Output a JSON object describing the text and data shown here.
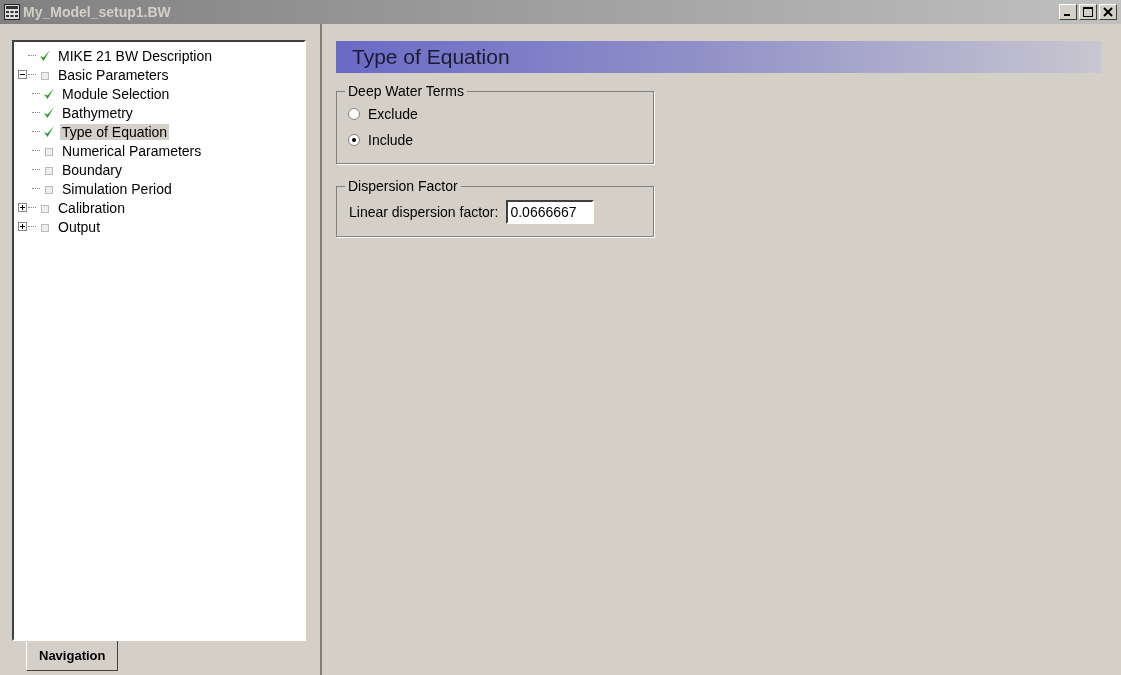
{
  "window": {
    "title": "My_Model_setup1.BW"
  },
  "tree": [
    {
      "label": "MIKE 21 BW Description",
      "checked": true,
      "selected": false
    },
    {
      "label": "Basic Parameters",
      "checked": false,
      "selected": false,
      "expanded": true,
      "children": [
        {
          "label": "Module Selection",
          "checked": true,
          "selected": false
        },
        {
          "label": "Bathymetry",
          "checked": true,
          "selected": false
        },
        {
          "label": "Type of Equation",
          "checked": true,
          "selected": true
        },
        {
          "label": "Numerical Parameters",
          "checked": false,
          "selected": false
        },
        {
          "label": "Boundary",
          "checked": false,
          "selected": false
        },
        {
          "label": "Simulation Period",
          "checked": false,
          "selected": false
        }
      ]
    },
    {
      "label": "Calibration",
      "checked": false,
      "selected": false,
      "expanded": false
    },
    {
      "label": "Output",
      "checked": false,
      "selected": false,
      "expanded": false
    }
  ],
  "tabs": [
    {
      "label": "Navigation",
      "selected": true
    }
  ],
  "page": {
    "title": "Type of Equation",
    "deep_water_terms": {
      "legend": "Deep Water Terms",
      "options": [
        {
          "label": "Exclude",
          "selected": false
        },
        {
          "label": "Include",
          "selected": true
        }
      ]
    },
    "dispersion_factor": {
      "legend": "Dispersion Factor",
      "label": "Linear dispersion factor:",
      "value": "0.0666667"
    }
  }
}
